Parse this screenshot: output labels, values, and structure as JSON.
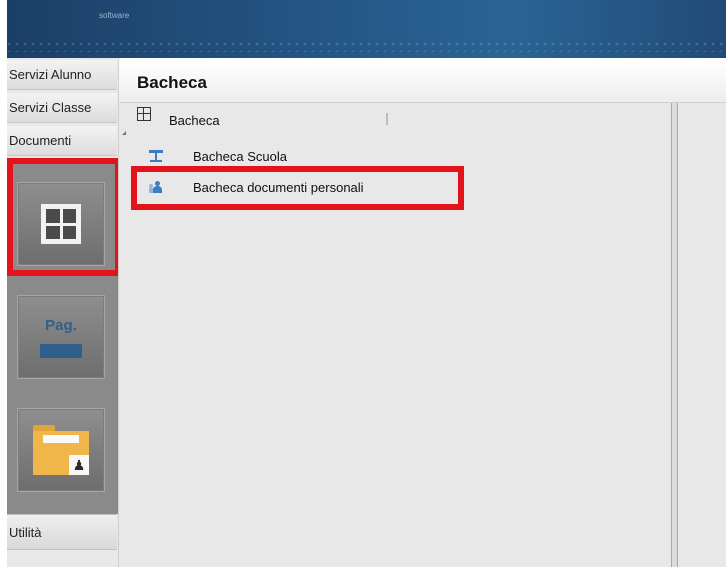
{
  "banner": {
    "logo_text": "",
    "tagline": "software",
    "right_text": ""
  },
  "sidebar": {
    "items": [
      {
        "label": "Servizi Alunno"
      },
      {
        "label": "Servizi Classe"
      },
      {
        "label": "Documenti"
      }
    ],
    "tiles": [
      {
        "icon": "bacheca-grid-icon",
        "selected": true
      },
      {
        "icon": "pag-icon",
        "label": "Pag."
      },
      {
        "icon": "folder-person-icon"
      }
    ],
    "bottom_item": {
      "label": "Utilità"
    }
  },
  "panel": {
    "title": "Bacheca",
    "tree": {
      "root": {
        "label": "Bacheca",
        "icon": "grid-icon"
      },
      "children": [
        {
          "label": "Bacheca Scuola",
          "icon": "school-board-icon"
        },
        {
          "label": "Bacheca documenti personali",
          "icon": "personal-docs-icon",
          "highlighted": true
        }
      ]
    }
  },
  "highlight_color": "#e3121b"
}
